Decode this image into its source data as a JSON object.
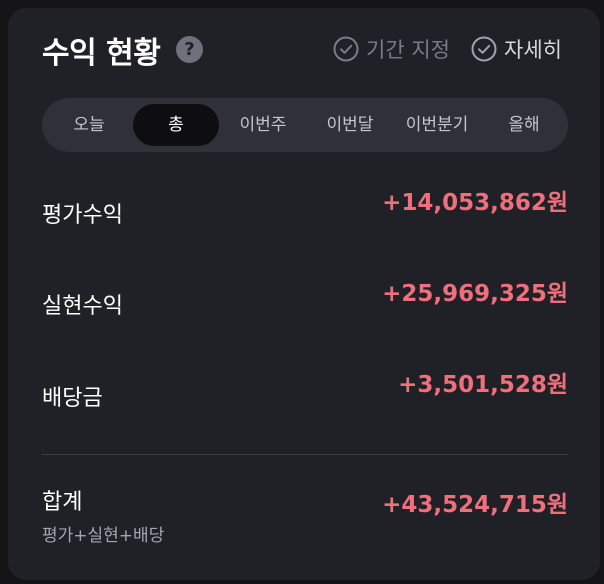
{
  "header": {
    "title": "수익 현황",
    "help_glyph": "?",
    "period_option_label": "기간 지정",
    "detail_option_label": "자세히"
  },
  "tabs": [
    {
      "label": "오늘",
      "active": false
    },
    {
      "label": "총",
      "active": true
    },
    {
      "label": "이번주",
      "active": false
    },
    {
      "label": "이번달",
      "active": false
    },
    {
      "label": "이번분기",
      "active": false
    },
    {
      "label": "올해",
      "active": false
    }
  ],
  "rows": {
    "valuation": {
      "label": "평가수익",
      "value": "+14,053,862원"
    },
    "realized": {
      "label": "실현수익",
      "value": "+25,969,325원"
    },
    "dividend": {
      "label": "배당금",
      "value": "+3,501,528원"
    }
  },
  "total": {
    "label": "합계",
    "sublabel": "평가+실현+배당",
    "value": "+43,524,715원"
  },
  "colors": {
    "background": "#141416",
    "card": "#202127",
    "positive": "#ef6f7c",
    "tab_bar": "#2f3138",
    "active_tab": "#0e0e10"
  },
  "icons": {
    "help": "question-circle-icon",
    "period_check": "check-circle-icon",
    "detail_check": "check-circle-icon"
  }
}
